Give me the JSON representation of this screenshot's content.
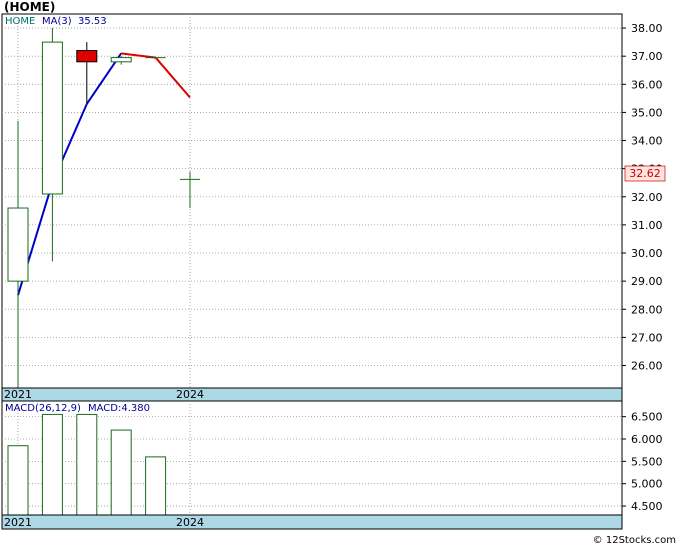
{
  "title": "(HOME)",
  "watermark": "© 12Stocks.com",
  "colors": {
    "up_candle": "#1a6b1a",
    "down_candle": "#e00000",
    "ma_up": "#0000cc",
    "ma_down": "#e00000",
    "axis_band": "#add8e6",
    "macd_bar": "#1a6b1a",
    "label_teal": "#007070",
    "label_blue": "#000099",
    "price_box": "#ffe4e1",
    "price_text": "#cc0000"
  },
  "chart_data": [
    {
      "type": "candlestick",
      "title": "(HOME)",
      "legend": {
        "symbol": "HOME",
        "ma_label": "MA(3)",
        "ma_value": "35.53"
      },
      "x_ticks": [
        {
          "label": "2021",
          "index": 0
        },
        {
          "label": "2024",
          "index": 5
        }
      ],
      "ylim": [
        25.2,
        38.5
      ],
      "y_ticks": [
        "38.00",
        "37.00",
        "36.00",
        "35.00",
        "34.00",
        "33.00",
        "32.00",
        "31.00",
        "30.00",
        "29.00",
        "28.00",
        "27.00",
        "26.00"
      ],
      "last_price": "32.62",
      "candles": [
        {
          "open": 29.0,
          "high": 34.7,
          "low": 25.2,
          "close": 31.6
        },
        {
          "open": 32.1,
          "high": 38.0,
          "low": 29.7,
          "close": 37.5
        },
        {
          "open": 37.2,
          "high": 37.5,
          "low": 35.3,
          "close": 36.8
        },
        {
          "open": 36.8,
          "high": 37.0,
          "low": 36.7,
          "close": 36.95
        },
        {
          "open": 36.95,
          "high": 36.95,
          "low": 36.95,
          "close": 36.95
        },
        {
          "open": 32.62,
          "high": 32.9,
          "low": 31.6,
          "close": 32.62
        }
      ],
      "ma": [
        {
          "index": 0,
          "value": 28.5
        },
        {
          "index": 1,
          "value": 32.5
        },
        {
          "index": 2,
          "value": 35.3
        },
        {
          "index": 3,
          "value": 37.1
        },
        {
          "index": 4,
          "value": 36.95
        },
        {
          "index": 5,
          "value": 35.53
        }
      ]
    },
    {
      "type": "bar",
      "legend": {
        "label": "MACD(26,12,9)",
        "value_label": "MACD:4.380"
      },
      "x_ticks": [
        {
          "label": "2021",
          "index": 0
        },
        {
          "label": "2024",
          "index": 5
        }
      ],
      "ylim": [
        4.3,
        6.85
      ],
      "y_ticks": [
        "6.500",
        "6.000",
        "5.500",
        "5.000",
        "4.500"
      ],
      "values": [
        5.85,
        6.55,
        6.55,
        6.2,
        5.6
      ]
    }
  ]
}
